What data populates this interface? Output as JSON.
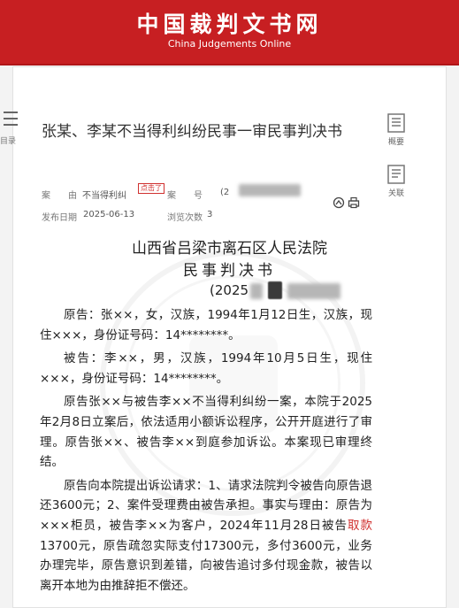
{
  "header": {
    "brand_cn": "中国裁判文书网",
    "brand_en": "China Judgements Online"
  },
  "sidebar": {
    "menu_label": "目录",
    "overview_label": "概要",
    "related_label": "关联"
  },
  "document": {
    "title": "张某、李某不当得利纠纷民事一审民事判决书",
    "meta": {
      "cause_key": "案　　由",
      "cause_value": "不当得利纠",
      "tip": "点击了",
      "case_no_key": "案　　号",
      "case_no_value": "(2",
      "date_key": "发布日期",
      "date_value": "2025-06-13",
      "views_key": "浏览次数",
      "views_value": "3"
    },
    "court_name": "山西省吕梁市离石区人民法院",
    "doc_type": "民事判决书",
    "case_no_prefix": "(2025",
    "paragraphs": [
      "原告：张××，女，汉族，1994年1月12日生，汉族，现住×××，身份证号码：14********。",
      "被告：李××，男，汉族，1994年10月5日生，现住×××，身份证号码：14********。",
      "原告张××与被告李××不当得利纠纷一案，本院于2025年2月8日立案后，依法适用小额诉讼程序，公开开庭进行了审理。原告张××、被告李××到庭参加诉讼。本案现已审理终结。"
    ],
    "claim_para": {
      "before": "原告向本院提出诉讼请求：1、请求法院判令被告向原告退还3600元；2、案件受理费由被告承担。事实与理由：原告为×××柜员，被告李××为客户，2024年11月28日被告",
      "link": "取款",
      "after": "13700元，原告疏忽实际支付17300元，多付3600元，业务办理完毕，原告意识到差错，向被告追讨多付现金款，被告以离开本地为由推辞拒不偿还。"
    }
  },
  "colors": {
    "brand_red": "#c71f22",
    "link_red": "#d0302f"
  },
  "icons": [
    "menu-icon",
    "overview-icon",
    "related-icon",
    "share-icon",
    "print-icon"
  ]
}
